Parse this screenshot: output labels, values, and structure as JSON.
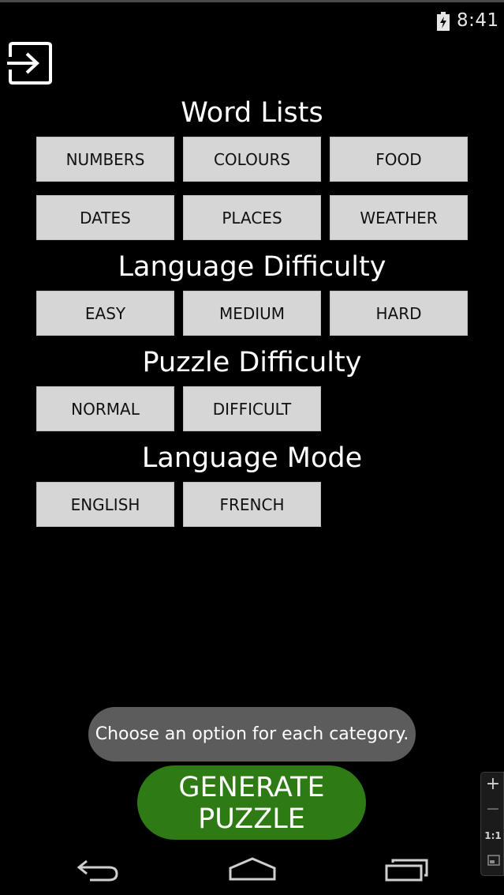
{
  "status_bar": {
    "time": "8:41"
  },
  "sections": {
    "word_lists": {
      "title": "Word Lists",
      "options": [
        "NUMBERS",
        "COLOURS",
        "FOOD",
        "DATES",
        "PLACES",
        "WEATHER"
      ]
    },
    "language_difficulty": {
      "title": "Language Difficulty",
      "options": [
        "EASY",
        "MEDIUM",
        "HARD"
      ]
    },
    "puzzle_difficulty": {
      "title": "Puzzle Difficulty",
      "options": [
        "NORMAL",
        "DIFFICULT"
      ]
    },
    "language_mode": {
      "title": "Language Mode",
      "options": [
        "ENGLISH",
        "FRENCH"
      ]
    }
  },
  "toast": {
    "text": "Choose an option for each category."
  },
  "generate_button": {
    "line1": "GENERATE",
    "line2": "PUZZLE"
  },
  "zoom_panel": {
    "plus": "+",
    "minus": "−",
    "reset": "1:1"
  },
  "colors": {
    "background": "#000000",
    "option_button": "#d6d6d6",
    "generate_button": "#2e7a14",
    "toast": "#5c5c5c"
  },
  "icons": {
    "exit": "exit-icon",
    "battery": "battery-charging-icon",
    "back": "back-icon",
    "home": "home-icon",
    "recent": "recent-apps-icon",
    "fit": "fit-screen-icon"
  }
}
